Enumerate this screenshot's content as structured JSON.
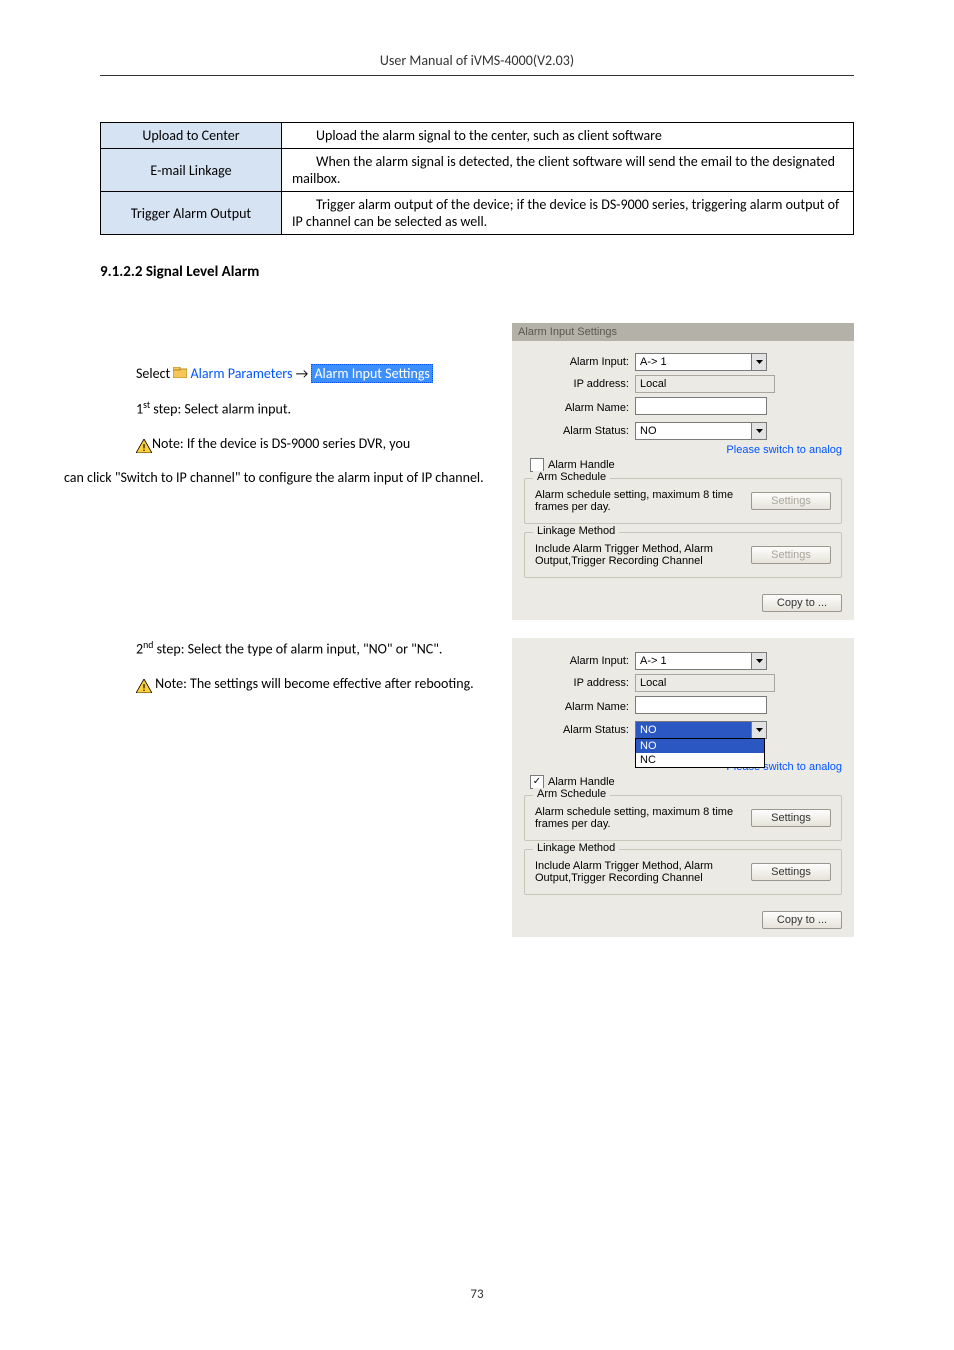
{
  "header": {
    "title": "User Manual of iVMS-4000(V2.03)"
  },
  "table": {
    "rows": [
      {
        "left": "Upload to Center",
        "right": "Upload the alarm signal to the center, such as client software"
      },
      {
        "left": "E-mail Linkage",
        "right": "When the alarm signal is detected, the client software will send the email to the designated mailbox."
      },
      {
        "left": "Trigger Alarm Output",
        "right": "Trigger alarm output of the device; if the device is DS-9000 series, triggering alarm output of IP channel can be selected as well."
      }
    ]
  },
  "section": {
    "heading": "9.1.2.2 Signal Level Alarm"
  },
  "left_text": {
    "select_prefix": "Select ",
    "alarm_params": "Alarm Parameters",
    "arrow": "→",
    "alarm_input_settings": "Alarm Input Settings",
    "step1": {
      "ord": "1",
      "sup": "st",
      "rest": " step: Select alarm input."
    },
    "note1": "Note: If the device is DS-9000 series DVR, you",
    "note1b": "can click \"Switch to IP channel\" to configure the alarm input of IP channel.",
    "step2": {
      "ord": "2",
      "sup": "nd",
      "rest": " step: Select the type of alarm input, \"NO\" or \"NC\"."
    },
    "note2": " Note: The settings will become effective after rebooting."
  },
  "dialog": {
    "title": "Alarm Input Settings",
    "labels": {
      "alarm_input": "Alarm Input:",
      "ip_address": "IP address:",
      "alarm_name": "Alarm Name:",
      "alarm_status": "Alarm Status:"
    },
    "values": {
      "alarm_input": "A-> 1",
      "ip_address": "Local",
      "alarm_name": "",
      "alarm_status": "NO"
    },
    "switch_link": "Please switch to analog",
    "alarm_handle": "Alarm Handle",
    "groups": {
      "arm": {
        "legend": "Arm Schedule",
        "text": "Alarm schedule setting, maximum 8 time frames per day.",
        "btn": "Settings"
      },
      "linkage": {
        "legend": "Linkage Method",
        "text": "Include Alarm Trigger Method, Alarm Output,Trigger Recording Channel",
        "btn": "Settings"
      }
    },
    "copy": "Copy to ..."
  },
  "dialog2": {
    "status_options": [
      "NO",
      "NC"
    ]
  },
  "page_number": "73"
}
